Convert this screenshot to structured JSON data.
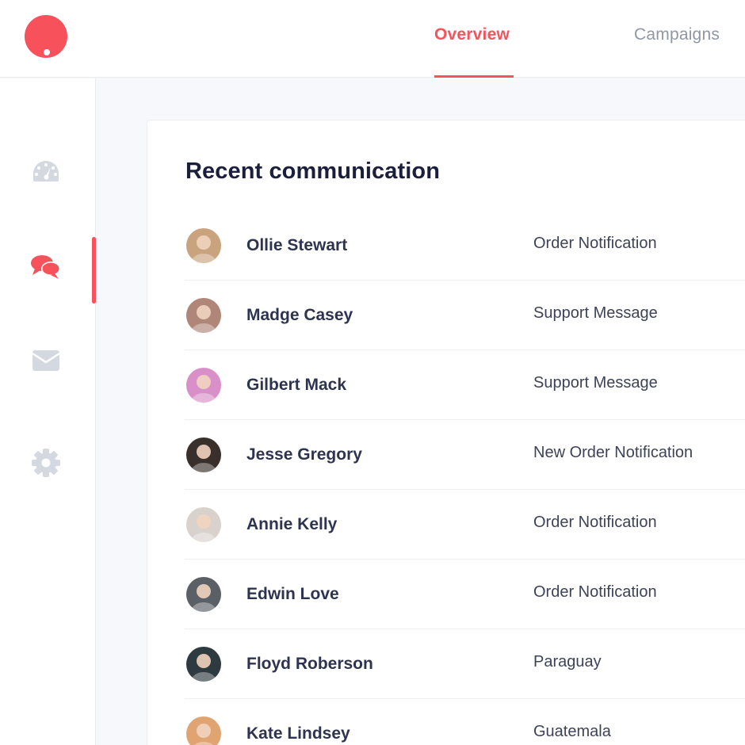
{
  "app": {
    "logo_icon": "logo-circle-icon",
    "accent_color": "#f7525c"
  },
  "header": {
    "tabs": [
      {
        "label": "Overview",
        "active": true
      },
      {
        "label": "Campaigns",
        "active": false
      }
    ]
  },
  "sidebar": {
    "items": [
      {
        "icon": "dashboard-icon",
        "active": false
      },
      {
        "icon": "chat-icon",
        "active": true
      },
      {
        "icon": "mail-icon",
        "active": false
      },
      {
        "icon": "gear-icon",
        "active": false
      }
    ]
  },
  "main": {
    "title": "Recent communication",
    "rows": [
      {
        "name": "Ollie Stewart",
        "type": "Order Notification",
        "avatar_color": "#c9a27e"
      },
      {
        "name": "Madge Casey",
        "type": "Support Message",
        "avatar_color": "#b08678"
      },
      {
        "name": "Gilbert Mack",
        "type": "Support Message",
        "avatar_color": "#d98fc7"
      },
      {
        "name": "Jesse Gregory",
        "type": "New Order Notification",
        "avatar_color": "#3a302b"
      },
      {
        "name": "Annie Kelly",
        "type": "Order Notification",
        "avatar_color": "#d9d2cc"
      },
      {
        "name": "Edwin Love",
        "type": "Order Notification",
        "avatar_color": "#5b6066"
      },
      {
        "name": "Floyd Roberson",
        "type": "Paraguay",
        "avatar_color": "#2d3a40"
      },
      {
        "name": "Kate Lindsey",
        "type": "Guatemala",
        "avatar_color": "#e0a473"
      }
    ]
  }
}
